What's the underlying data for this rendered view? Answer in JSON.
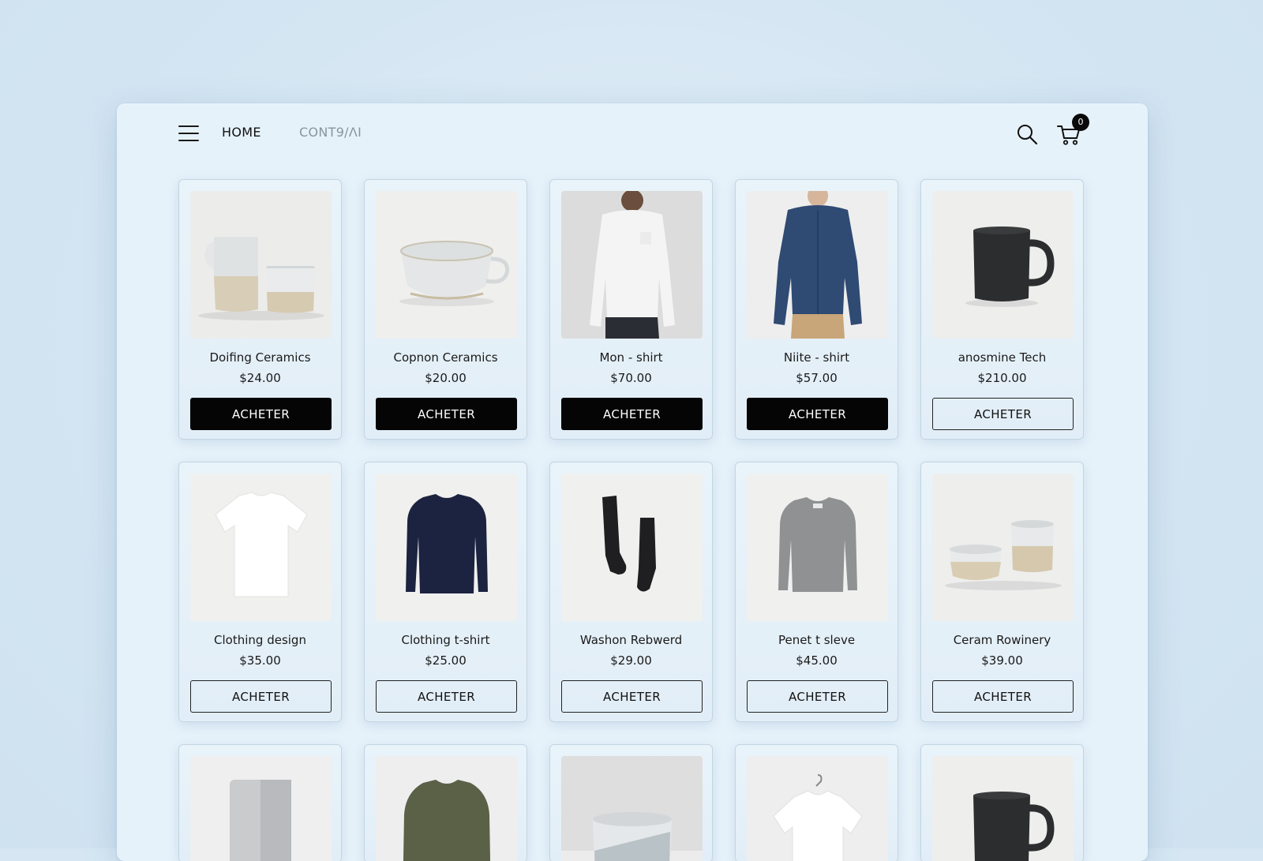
{
  "nav": {
    "home": "HOME",
    "contact": "CONT9/ΛΙ",
    "cart_count": "0"
  },
  "products": [
    {
      "name": "Doifing Ceramics",
      "price": "$24.00",
      "button": "ACHETER",
      "style": "solid",
      "image": "ceramic-pitcher-and-cup"
    },
    {
      "name": "Copnon Ceramics",
      "price": "$20.00",
      "button": "ACHETER",
      "style": "solid",
      "image": "ceramic-cup"
    },
    {
      "name": "Mon - shirt",
      "price": "$70.00",
      "button": "ACHETER",
      "style": "solid",
      "image": "white-longsleeve-shirt"
    },
    {
      "name": "Niite - shirt",
      "price": "$57.00",
      "button": "ACHETER",
      "style": "solid",
      "image": "blue-button-shirt"
    },
    {
      "name": "anosmine Tech",
      "price": "$210.00",
      "button": "ACHETER",
      "style": "outline",
      "image": "black-mug"
    },
    {
      "name": "Clothing design",
      "price": "$35.00",
      "button": "ACHETER",
      "style": "outline",
      "image": "white-tshirt"
    },
    {
      "name": "Clothing t-shirt",
      "price": "$25.00",
      "button": "ACHETER",
      "style": "outline",
      "image": "navy-sweater"
    },
    {
      "name": "Washon Rebwerd",
      "price": "$29.00",
      "button": "ACHETER",
      "style": "outline",
      "image": "black-socks"
    },
    {
      "name": "Penet t sleve",
      "price": "$45.00",
      "button": "ACHETER",
      "style": "outline",
      "image": "grey-sweater"
    },
    {
      "name": "Ceram Rowinery",
      "price": "$39.00",
      "button": "ACHETER",
      "style": "outline",
      "image": "ceramic-bowls"
    }
  ],
  "partial_products": [
    {
      "image": "metal-panel"
    },
    {
      "image": "olive-sweater"
    },
    {
      "image": "ceramic-bowl"
    },
    {
      "image": "hanging-tshirt"
    },
    {
      "image": "black-mug"
    }
  ],
  "colors": {
    "background": "#d6e7f3",
    "panel": "#e6f2fa",
    "button_solid": "#050505",
    "text": "#1a1a1a"
  }
}
